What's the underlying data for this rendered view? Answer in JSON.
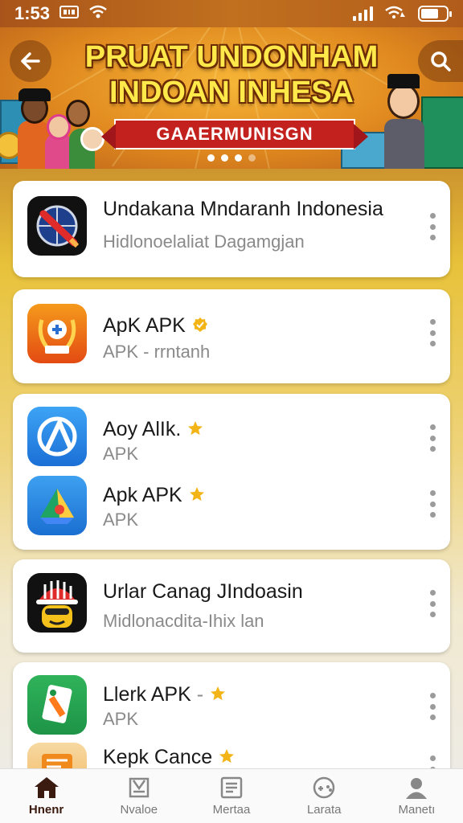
{
  "status": {
    "time": "1:53"
  },
  "banner": {
    "title_line1": "PRUAT UNDONHAM",
    "title_line2": "INDOAN INHESA",
    "ribbon": "GAAERMUNISGN",
    "slide_count": 4,
    "active_slide": 0,
    "colors": {
      "title": "#ffe94a",
      "ribbon": "#c3211e"
    }
  },
  "apps": [
    {
      "card": 1,
      "title": "Undakana Mndaranh Indonesia",
      "subtitle": "Hidlonoelaliat Dagamgjan",
      "badge": false,
      "icon": "globe-pen-icon"
    },
    {
      "card": 2,
      "title": "ApK APK",
      "subtitle": "APK - rrntanh",
      "badge": true,
      "icon": "laurel-shield-icon"
    },
    {
      "card": 3,
      "title": "Aoy AlIk.",
      "subtitle": "APK",
      "badge": true,
      "icon": "compass-a-icon"
    },
    {
      "card": 3,
      "title": "Apk APK",
      "subtitle": "APK",
      "badge": true,
      "icon": "drive-triangle-icon"
    },
    {
      "card": 4,
      "title": "Urlar Canag JIndoasin",
      "subtitle": "Midlonacdita-Ihix lan",
      "badge": false,
      "icon": "hardhat-worker-icon"
    },
    {
      "card": 5,
      "title": "Llerk APK",
      "subtitle": "APK",
      "badge": true,
      "icon": "green-doc-icon"
    },
    {
      "card": 5,
      "title": "Kepk Cance",
      "subtitle": "",
      "badge": true,
      "icon": "orange-card-icon"
    }
  ],
  "nav": [
    {
      "label": "Hnenr",
      "icon": "home-icon",
      "active": true
    },
    {
      "label": "Nvaloe",
      "icon": "apps-icon",
      "active": false
    },
    {
      "label": "Mertaa",
      "icon": "document-icon",
      "active": false
    },
    {
      "label": "Larata",
      "icon": "games-icon",
      "active": false
    },
    {
      "label": "Manetı",
      "icon": "profile-icon",
      "active": false
    }
  ]
}
